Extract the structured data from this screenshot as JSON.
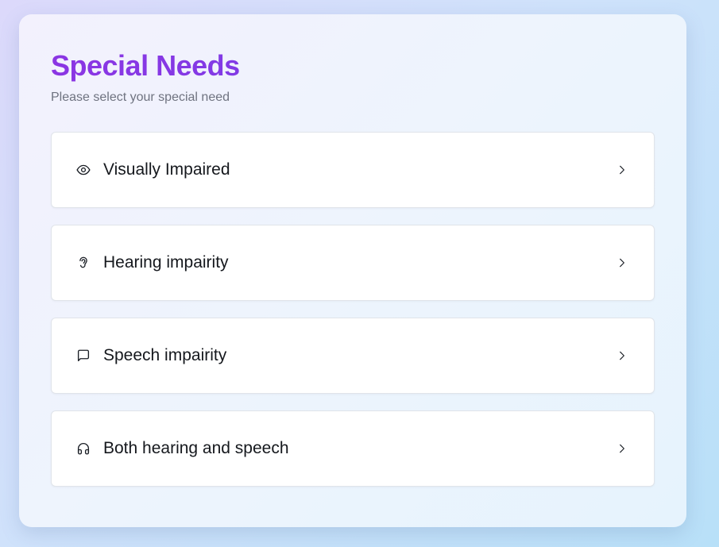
{
  "header": {
    "title": "Special Needs",
    "subtitle": "Please select your special need"
  },
  "options": [
    {
      "label": "Visually Impaired",
      "icon": "eye-icon"
    },
    {
      "label": "Hearing impairity",
      "icon": "ear-icon"
    },
    {
      "label": "Speech impairity",
      "icon": "message-square-icon"
    },
    {
      "label": "Both hearing and speech",
      "icon": "headphones-icon"
    }
  ],
  "colors": {
    "title_gradient_start": "#8b35e3",
    "title_gradient_end": "#6d46ea",
    "subtitle": "#6f7380",
    "card_background": "#f0f3fd",
    "option_background": "#ffffff",
    "option_border": "#e0e4ea"
  }
}
